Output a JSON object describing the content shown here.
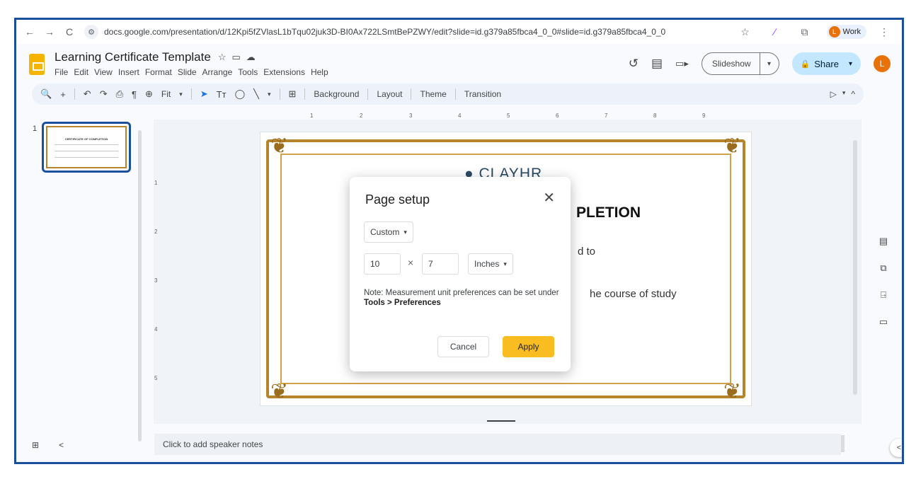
{
  "browser": {
    "back": "←",
    "forward": "→",
    "reload": "C",
    "site_icon": "⚙",
    "url": "docs.google.com/presentation/d/12Kpi5fZVlasL1bTqu02juk3D-BI0Ax722LSmtBePZWY/edit?slide=id.g379a85fbca4_0_0#slide=id.g379a85fbca4_0_0",
    "star": "☆",
    "pen": "∕",
    "extensions": "⧉",
    "profile_initial": "L",
    "profile_label": "Work",
    "menu": "⋮"
  },
  "doc": {
    "title": "Learning Certificate Template",
    "star_icon": "☆",
    "folder_icon": "▭",
    "cloud_icon": "☁",
    "menu": [
      "File",
      "Edit",
      "View",
      "Insert",
      "Format",
      "Slide",
      "Arrange",
      "Tools",
      "Extensions",
      "Help"
    ],
    "history_icon": "↺",
    "comment_icon": "▤",
    "meet_icon": "▭▸",
    "slideshow_label": "Slideshow",
    "slideshow_caret": "▾",
    "share_label": "Share",
    "share_lock": "🔒",
    "share_caret": "▾",
    "avatar": "L"
  },
  "toolbar": {
    "search": "🔍",
    "add": "+",
    "undo": "↶",
    "redo": "↷",
    "print": "⎙",
    "paint": "¶",
    "zoom_icon": "⊕",
    "zoom": "Fit",
    "zoom_caret": "▾",
    "select": "➤",
    "textbox": "Tт",
    "shape": "◯",
    "line": "╲",
    "line_caret": "▾",
    "comment": "⊞",
    "background": "Background",
    "layout": "Layout",
    "theme": "Theme",
    "transition": "Transition",
    "pen_icon": "▷",
    "right_caret": "▾",
    "collapse": "^"
  },
  "filmstrip": {
    "slide_number": "1",
    "thumb_title": "CERTIFICATE OF COMPLETION"
  },
  "ruler": {
    "h_marks": [
      "1",
      "2",
      "3",
      "4",
      "5",
      "6",
      "7",
      "8",
      "9"
    ],
    "v_marks": [
      "1",
      "2",
      "3",
      "4",
      "5"
    ]
  },
  "slide": {
    "logo": "● CLAYHR",
    "heading": "PLETION",
    "line1": "d to",
    "line2": "he course of study"
  },
  "side_panel": {
    "icons": [
      "▤",
      "⧉",
      "⍈",
      "▭"
    ]
  },
  "notes": {
    "placeholder": "Click to add speaker notes"
  },
  "bottom": {
    "grid_icon": "⊞",
    "prev_icon": "<",
    "collapse_icon": "<"
  },
  "dialog": {
    "title": "Page setup",
    "close": "✕",
    "preset": "Custom",
    "preset_caret": "▾",
    "width": "10",
    "times": "×",
    "height": "7",
    "unit": "Inches",
    "unit_caret": "▾",
    "note_prefix": "Note: Measurement unit preferences can be set under",
    "note_path": "Tools > Preferences",
    "cancel": "Cancel",
    "apply": "Apply"
  }
}
